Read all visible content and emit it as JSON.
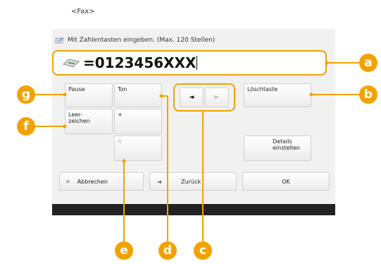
{
  "screen_label": "<Fax>",
  "dialog_title": "Mit Zahlentasten eingeben. (Max. 120 Stellen)",
  "number_value": "=0123456XXX",
  "keys": {
    "pause": "Pause",
    "ton": "Ton",
    "space": "Leer-\nzeichen",
    "plus": "+",
    "r": "R",
    "delete": "Löschtaste",
    "details": "Details\neinstellen"
  },
  "arrows": {
    "left": "◄",
    "right": "►"
  },
  "footer": {
    "cancel": "Abbrechen",
    "back": "Zurück",
    "ok": "OK"
  },
  "callouts": [
    "a",
    "b",
    "c",
    "d",
    "e",
    "f",
    "g"
  ],
  "colors": {
    "accent": "#f2a200",
    "bar": "#222222"
  },
  "icons": [
    "edit-pen-icon",
    "fax-icon",
    "close-icon",
    "back-arrow-icon"
  ]
}
